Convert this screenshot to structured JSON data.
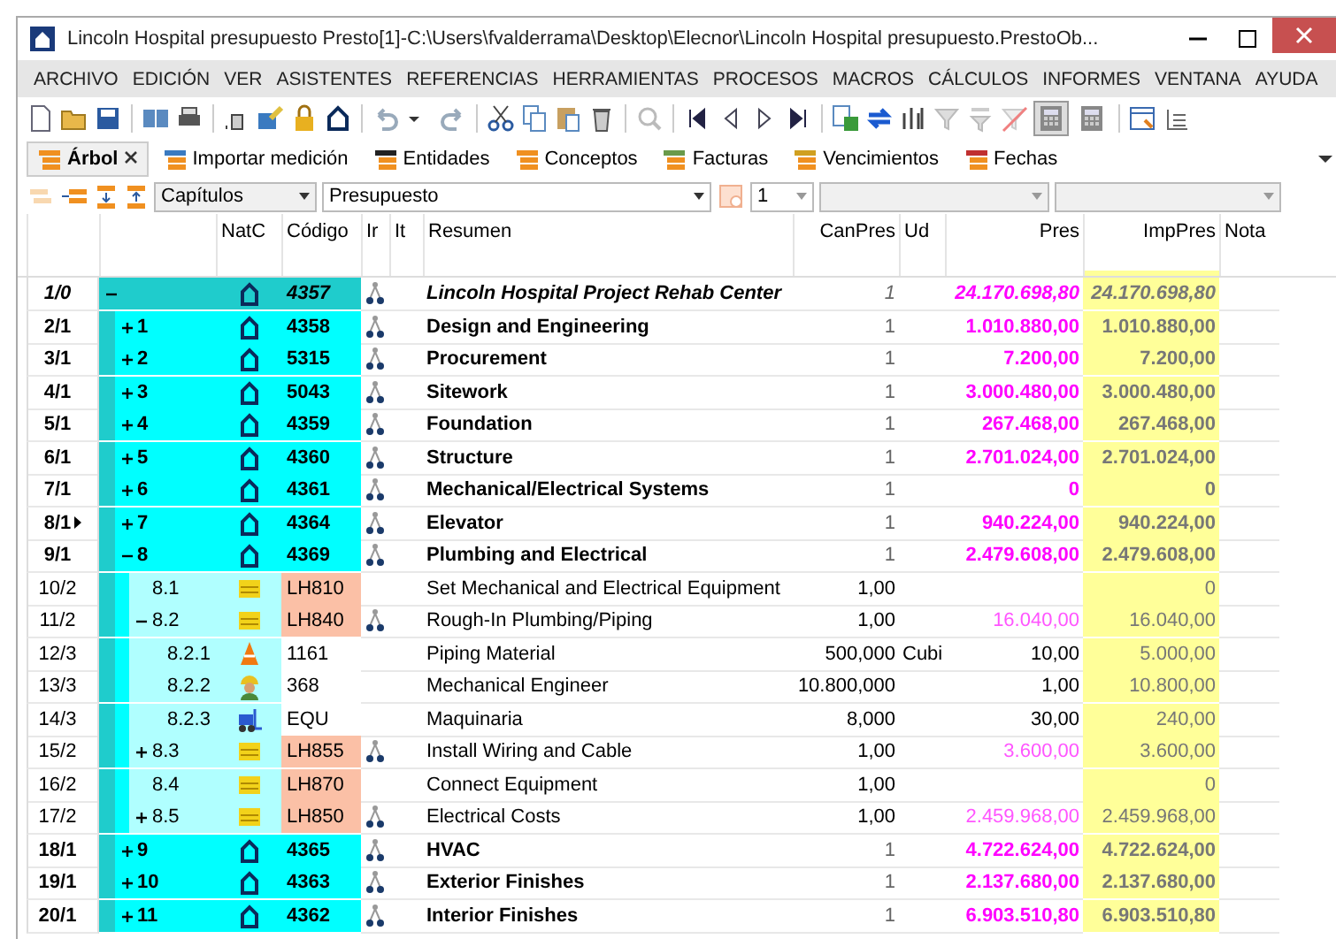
{
  "window": {
    "title": "Lincoln Hospital presupuesto Presto[1]-C:\\Users\\fvalderrama\\Desktop\\Elecnor\\Lincoln Hospital presupuesto.PrestoOb..."
  },
  "menu": [
    "ARCHIVO",
    "EDICIÓN",
    "VER",
    "ASISTENTES",
    "REFERENCIAS",
    "HERRAMIENTAS",
    "PROCESOS",
    "MACROS",
    "CÁLCULOS",
    "INFORMES",
    "VENTANA",
    "AYUDA"
  ],
  "toolbar_toggles": [
    {
      "pressed": true
    },
    {
      "pressed": false
    }
  ],
  "tabs": [
    {
      "label": "Árbol",
      "selected": true,
      "closable": true
    },
    {
      "label": "Importar medición",
      "selected": false
    },
    {
      "label": "Entidades",
      "selected": false
    },
    {
      "label": "Conceptos",
      "selected": false
    },
    {
      "label": "Facturas",
      "selected": false
    },
    {
      "label": "Vencimientos",
      "selected": false
    },
    {
      "label": "Fechas",
      "selected": false
    }
  ],
  "filters": {
    "level": "Capítulos",
    "view": "Presupuesto",
    "depth": "1"
  },
  "table": {
    "columns": [
      "NatC",
      "Código",
      "Ir",
      "It",
      "Resumen",
      "CanPres",
      "Ud",
      "Pres",
      "ImpPres",
      "Nota"
    ],
    "rows": [
      {
        "row": "1/0",
        "expanded": true,
        "kind": "chapter",
        "code": "4357",
        "decomposed": true,
        "summary": "Lincoln Hospital Project Rehab Center",
        "quantity": "1",
        "price": "24.170.698,80",
        "price_computed": true,
        "amount": "24.170.698,80",
        "selected": false,
        "children": [
          {
            "row": "2/1",
            "label": "1",
            "expanded": false,
            "kind": "chapter",
            "code": "4358",
            "decomposed": true,
            "summary": "Design and Engineering",
            "quantity": "1",
            "price": "1.010.880,00",
            "price_computed": true,
            "amount": "1.010.880,00",
            "selected": false
          },
          {
            "row": "3/1",
            "label": "2",
            "expanded": false,
            "kind": "chapter",
            "code": "5315",
            "decomposed": true,
            "summary": "Procurement",
            "quantity": "1",
            "price": "7.200,00",
            "price_computed": true,
            "amount": "7.200,00",
            "selected": false
          },
          {
            "row": "4/1",
            "label": "3",
            "expanded": false,
            "kind": "chapter",
            "code": "5043",
            "decomposed": true,
            "summary": "Sitework",
            "quantity": "1",
            "price": "3.000.480,00",
            "price_computed": true,
            "amount": "3.000.480,00",
            "selected": false
          },
          {
            "row": "5/1",
            "label": "4",
            "expanded": false,
            "kind": "chapter",
            "code": "4359",
            "decomposed": true,
            "summary": "Foundation",
            "quantity": "1",
            "price": "267.468,00",
            "price_computed": true,
            "amount": "267.468,00",
            "selected": false
          },
          {
            "row": "6/1",
            "label": "5",
            "expanded": false,
            "kind": "chapter",
            "code": "4360",
            "decomposed": true,
            "summary": "Structure",
            "quantity": "1",
            "price": "2.701.024,00",
            "price_computed": true,
            "amount": "2.701.024,00",
            "selected": false
          },
          {
            "row": "7/1",
            "label": "6",
            "expanded": false,
            "kind": "chapter",
            "code": "4361",
            "decomposed": true,
            "summary": "Mechanical/Electrical Systems",
            "quantity": "1",
            "price": "0",
            "price_computed": true,
            "amount": "0",
            "selected": false
          },
          {
            "row": "8/1",
            "label": "7",
            "expanded": false,
            "kind": "chapter",
            "code": "4364",
            "decomposed": true,
            "summary": "Elevator",
            "quantity": "1",
            "price": "940.224,00",
            "price_computed": true,
            "amount": "940.224,00",
            "selected": true
          },
          {
            "row": "9/1",
            "label": "8",
            "expanded": true,
            "kind": "chapter",
            "code": "4369",
            "decomposed": true,
            "summary": "Plumbing and Electrical",
            "quantity": "1",
            "price": "2.479.608,00",
            "price_computed": true,
            "amount": "2.479.608,00",
            "selected": false,
            "children": [
              {
                "row": "10/2",
                "label": "8.1",
                "kind": "item",
                "code": "LH810",
                "decomposed": false,
                "summary": "Set Mechanical and Electrical Equipment",
                "quantity": "1,00",
                "price_computed": true,
                "amount": "0",
                "selected": false
              },
              {
                "row": "11/2",
                "label": "8.2",
                "expanded": true,
                "kind": "item",
                "code": "LH840",
                "decomposed": true,
                "summary": "Rough-In Plumbing/Piping",
                "quantity": "1,00",
                "price": "16.040,00",
                "price_computed": true,
                "amount": "16.040,00",
                "selected": false,
                "children": [
                  {
                    "row": "12/3",
                    "label": "8.2.1",
                    "kind": "material",
                    "code": "1161",
                    "decomposed": false,
                    "summary": "Piping Material",
                    "quantity": "500,000",
                    "unit": "Cubi",
                    "price": "10,00",
                    "price_computed": false,
                    "amount": "5.000,00",
                    "selected": false
                  },
                  {
                    "row": "13/3",
                    "label": "8.2.2",
                    "kind": "labor",
                    "code": "368",
                    "decomposed": false,
                    "summary": "Mechanical Engineer",
                    "quantity": "10.800,000",
                    "price": "1,00",
                    "price_computed": false,
                    "amount": "10.800,00",
                    "selected": false
                  },
                  {
                    "row": "14/3",
                    "label": "8.2.3",
                    "kind": "machinery",
                    "code": "EQU",
                    "decomposed": false,
                    "summary": "Maquinaria",
                    "quantity": "8,000",
                    "price": "30,00",
                    "price_computed": false,
                    "amount": "240,00",
                    "selected": false
                  }
                ]
              },
              {
                "row": "15/2",
                "label": "8.3",
                "expanded": false,
                "kind": "item",
                "code": "LH855",
                "decomposed": true,
                "summary": "Install Wiring and Cable",
                "quantity": "1,00",
                "price": "3.600,00",
                "price_computed": true,
                "amount": "3.600,00",
                "selected": false
              },
              {
                "row": "16/2",
                "label": "8.4",
                "kind": "item",
                "code": "LH870",
                "decomposed": false,
                "summary": "Connect Equipment",
                "quantity": "1,00",
                "price_computed": true,
                "amount": "0",
                "selected": false
              },
              {
                "row": "17/2",
                "label": "8.5",
                "expanded": false,
                "kind": "item",
                "code": "LH850",
                "decomposed": true,
                "summary": "Electrical Costs",
                "quantity": "1,00",
                "price": "2.459.968,00",
                "price_computed": true,
                "amount": "2.459.968,00",
                "selected": false
              }
            ]
          },
          {
            "row": "18/1",
            "label": "9",
            "expanded": false,
            "kind": "chapter",
            "code": "4365",
            "decomposed": true,
            "summary": "HVAC",
            "quantity": "1",
            "price": "4.722.624,00",
            "price_computed": true,
            "amount": "4.722.624,00",
            "selected": false
          },
          {
            "row": "19/1",
            "label": "10",
            "expanded": false,
            "kind": "chapter",
            "code": "4363",
            "decomposed": true,
            "summary": "Exterior Finishes",
            "quantity": "1",
            "price": "2.137.680,00",
            "price_computed": true,
            "amount": "2.137.680,00",
            "selected": false
          },
          {
            "row": "20/1",
            "label": "11",
            "expanded": false,
            "kind": "chapter",
            "code": "4362",
            "decomposed": true,
            "summary": "Interior Finishes",
            "quantity": "1",
            "price": "6.903.510,80",
            "price_computed": true,
            "amount": "6.903.510,80",
            "selected": false
          }
        ]
      }
    ]
  }
}
